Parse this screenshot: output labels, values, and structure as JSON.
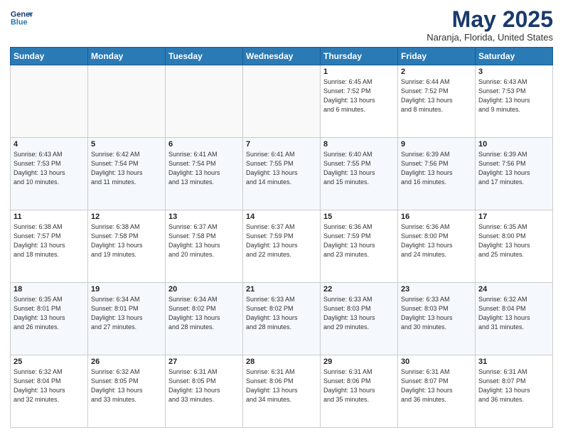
{
  "header": {
    "logo_line1": "General",
    "logo_line2": "Blue",
    "month_title": "May 2025",
    "location": "Naranja, Florida, United States"
  },
  "weekdays": [
    "Sunday",
    "Monday",
    "Tuesday",
    "Wednesday",
    "Thursday",
    "Friday",
    "Saturday"
  ],
  "weeks": [
    [
      {
        "num": "",
        "info": ""
      },
      {
        "num": "",
        "info": ""
      },
      {
        "num": "",
        "info": ""
      },
      {
        "num": "",
        "info": ""
      },
      {
        "num": "1",
        "info": "Sunrise: 6:45 AM\nSunset: 7:52 PM\nDaylight: 13 hours\nand 6 minutes."
      },
      {
        "num": "2",
        "info": "Sunrise: 6:44 AM\nSunset: 7:52 PM\nDaylight: 13 hours\nand 8 minutes."
      },
      {
        "num": "3",
        "info": "Sunrise: 6:43 AM\nSunset: 7:53 PM\nDaylight: 13 hours\nand 9 minutes."
      }
    ],
    [
      {
        "num": "4",
        "info": "Sunrise: 6:43 AM\nSunset: 7:53 PM\nDaylight: 13 hours\nand 10 minutes."
      },
      {
        "num": "5",
        "info": "Sunrise: 6:42 AM\nSunset: 7:54 PM\nDaylight: 13 hours\nand 11 minutes."
      },
      {
        "num": "6",
        "info": "Sunrise: 6:41 AM\nSunset: 7:54 PM\nDaylight: 13 hours\nand 13 minutes."
      },
      {
        "num": "7",
        "info": "Sunrise: 6:41 AM\nSunset: 7:55 PM\nDaylight: 13 hours\nand 14 minutes."
      },
      {
        "num": "8",
        "info": "Sunrise: 6:40 AM\nSunset: 7:55 PM\nDaylight: 13 hours\nand 15 minutes."
      },
      {
        "num": "9",
        "info": "Sunrise: 6:39 AM\nSunset: 7:56 PM\nDaylight: 13 hours\nand 16 minutes."
      },
      {
        "num": "10",
        "info": "Sunrise: 6:39 AM\nSunset: 7:56 PM\nDaylight: 13 hours\nand 17 minutes."
      }
    ],
    [
      {
        "num": "11",
        "info": "Sunrise: 6:38 AM\nSunset: 7:57 PM\nDaylight: 13 hours\nand 18 minutes."
      },
      {
        "num": "12",
        "info": "Sunrise: 6:38 AM\nSunset: 7:58 PM\nDaylight: 13 hours\nand 19 minutes."
      },
      {
        "num": "13",
        "info": "Sunrise: 6:37 AM\nSunset: 7:58 PM\nDaylight: 13 hours\nand 20 minutes."
      },
      {
        "num": "14",
        "info": "Sunrise: 6:37 AM\nSunset: 7:59 PM\nDaylight: 13 hours\nand 22 minutes."
      },
      {
        "num": "15",
        "info": "Sunrise: 6:36 AM\nSunset: 7:59 PM\nDaylight: 13 hours\nand 23 minutes."
      },
      {
        "num": "16",
        "info": "Sunrise: 6:36 AM\nSunset: 8:00 PM\nDaylight: 13 hours\nand 24 minutes."
      },
      {
        "num": "17",
        "info": "Sunrise: 6:35 AM\nSunset: 8:00 PM\nDaylight: 13 hours\nand 25 minutes."
      }
    ],
    [
      {
        "num": "18",
        "info": "Sunrise: 6:35 AM\nSunset: 8:01 PM\nDaylight: 13 hours\nand 26 minutes."
      },
      {
        "num": "19",
        "info": "Sunrise: 6:34 AM\nSunset: 8:01 PM\nDaylight: 13 hours\nand 27 minutes."
      },
      {
        "num": "20",
        "info": "Sunrise: 6:34 AM\nSunset: 8:02 PM\nDaylight: 13 hours\nand 28 minutes."
      },
      {
        "num": "21",
        "info": "Sunrise: 6:33 AM\nSunset: 8:02 PM\nDaylight: 13 hours\nand 28 minutes."
      },
      {
        "num": "22",
        "info": "Sunrise: 6:33 AM\nSunset: 8:03 PM\nDaylight: 13 hours\nand 29 minutes."
      },
      {
        "num": "23",
        "info": "Sunrise: 6:33 AM\nSunset: 8:03 PM\nDaylight: 13 hours\nand 30 minutes."
      },
      {
        "num": "24",
        "info": "Sunrise: 6:32 AM\nSunset: 8:04 PM\nDaylight: 13 hours\nand 31 minutes."
      }
    ],
    [
      {
        "num": "25",
        "info": "Sunrise: 6:32 AM\nSunset: 8:04 PM\nDaylight: 13 hours\nand 32 minutes."
      },
      {
        "num": "26",
        "info": "Sunrise: 6:32 AM\nSunset: 8:05 PM\nDaylight: 13 hours\nand 33 minutes."
      },
      {
        "num": "27",
        "info": "Sunrise: 6:31 AM\nSunset: 8:05 PM\nDaylight: 13 hours\nand 33 minutes."
      },
      {
        "num": "28",
        "info": "Sunrise: 6:31 AM\nSunset: 8:06 PM\nDaylight: 13 hours\nand 34 minutes."
      },
      {
        "num": "29",
        "info": "Sunrise: 6:31 AM\nSunset: 8:06 PM\nDaylight: 13 hours\nand 35 minutes."
      },
      {
        "num": "30",
        "info": "Sunrise: 6:31 AM\nSunset: 8:07 PM\nDaylight: 13 hours\nand 36 minutes."
      },
      {
        "num": "31",
        "info": "Sunrise: 6:31 AM\nSunset: 8:07 PM\nDaylight: 13 hours\nand 36 minutes."
      }
    ]
  ]
}
